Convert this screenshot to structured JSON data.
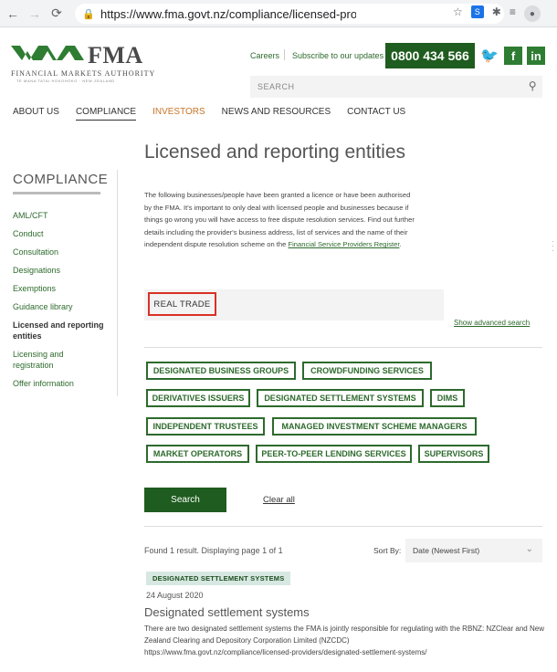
{
  "browser": {
    "url": "https://www.fma.govt.nz/compliance/licensed-provide...",
    "back_icon": "arrow-left-icon",
    "forward_icon": "arrow-right-icon",
    "reload_icon": "reload-icon"
  },
  "header": {
    "logo_text": "FMA",
    "logo_subtitle": "FINANCIAL MARKETS AUTHORITY",
    "logo_tagline": "TE MANA TATAI HOKOHOKO · NEW ZEALAND",
    "careers": "Careers",
    "subscribe": "Subscribe to our updates",
    "phone": "0800 434 566",
    "search_placeholder": "SEARCH"
  },
  "nav": {
    "items": [
      "ABOUT US",
      "COMPLIANCE",
      "INVESTORS",
      "NEWS AND RESOURCES",
      "CONTACT US"
    ]
  },
  "sidebar": {
    "title": "COMPLIANCE",
    "items": [
      "AML/CFT",
      "Conduct",
      "Consultation",
      "Designations",
      "Exemptions",
      "Guidance library",
      "Licensed and reporting entities",
      "Licensing and registration",
      "Offer information"
    ]
  },
  "main": {
    "title": "Licensed and reporting entities",
    "intro": "The following businesses/people have been granted a licence or have been authorised by the FMA. It's important to only deal with licensed people and businesses because if things go wrong you will have access to free dispute resolution services. Find out further details including the provider's business address, list of services and the name of their independent dispute resolution scheme on the ",
    "intro_link": "Financial Service Providers Register",
    "intro_end": ".",
    "query_value": "REAL TRADE",
    "advanced_search": "Show advanced search",
    "filters": [
      "DESIGNATED BUSINESS GROUPS",
      "CROWDFUNDING SERVICES",
      "DERIVATIVES ISSUERS",
      "DESIGNATED SETTLEMENT SYSTEMS",
      "DIMS",
      "INDEPENDENT TRUSTEES",
      "MANAGED INVESTMENT SCHEME MANAGERS",
      "MARKET OPERATORS",
      "PEER-TO-PEER LENDING SERVICES",
      "SUPERVISORS"
    ],
    "search_button": "Search",
    "clear_all": "Clear all"
  },
  "results": {
    "count_text": "Found 1 result. Displaying page 1 of 1",
    "sort_label": "Sort By:",
    "sort_value": "Date (Newest First)",
    "items": [
      {
        "badge": "DESIGNATED SETTLEMENT SYSTEMS",
        "date": "24 August 2020",
        "title": "Designated settlement systems",
        "description": "There are two designated settlement systems the FMA is jointly responsible for regulating with the RBNZ: NZClear and New Zealand Clearing and Depository Corporation Limited (NZCDC)",
        "url": "https://www.fma.govt.nz/compliance/licensed-providers/designated-settlement-systems/"
      }
    ]
  },
  "colors": {
    "brand_green": "#1f5c1f",
    "link_green": "#2d6a2d",
    "investors_orange": "#c87528",
    "highlight_red": "#d93025"
  }
}
